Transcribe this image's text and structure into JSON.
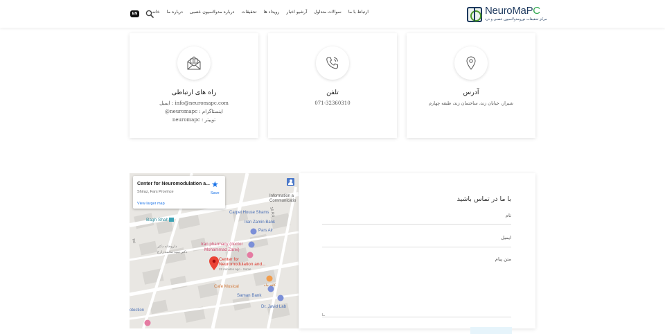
{
  "header": {
    "logo_text_main": "NeuroMaP",
    "logo_text_tail": "C",
    "logo_sub": "مرکز تحقیقات نورومدولاسیون عصبی و درد",
    "nav": [
      "خانه",
      "درباره ما",
      "درباره مدولاسیون عصبی",
      "تحقیقات",
      "رویداد ها",
      "آرشیو اخبار",
      "سوالات متداول",
      "ارتباط با ما"
    ],
    "lang": "EN"
  },
  "cards": {
    "contact": {
      "title": "راه های ارتباطی",
      "lines": [
        "info@neuromapc.com : ایمیل",
        "اینستاگرام : neuromapc@",
        "توییتر : neuromapc"
      ]
    },
    "phone": {
      "title": "تلفن",
      "lines": [
        "071-32360310"
      ]
    },
    "address": {
      "title": "آدرس",
      "lines": [
        "شیراز، خیابان زند، ساختمان زند، طبقه چهارم"
      ]
    }
  },
  "map": {
    "place_title": "Center for Neuromodulation a...",
    "place_sub": "Shiraz, Fars Province",
    "view_larger": "View larger map",
    "save": "Save",
    "labels": {
      "bagh_shah": "Bagh Shah",
      "caravan": "Carpet House Shams",
      "iran_zamin": "Iran Zamin Bank",
      "pars_air": "Pars Air",
      "info_comm_1": "Information a",
      "info_comm_2": "Communicatio",
      "street_16": "16 Rd",
      "pharmacy_fa_1": "داروخانه دکتر",
      "pharmacy_fa_2": "دکتر سید محمد زارع",
      "pharmacy_1": "Iran pharmacy (doctor",
      "pharmacy_2": "Mohammad Zarei)",
      "center_1": "Center for",
      "center_2": "Neuromodulation and...",
      "center_3": "22 minutes ago · Some",
      "cafe": "Cafe Musical",
      "cafe_fa": "کافه ماه",
      "saman": "Saman Bank",
      "javid": "Dr. Javid Lab",
      "protection": "otection",
      "road_left": "Rd"
    }
  },
  "form": {
    "title": "با ما در تماس باشید",
    "name_label": "نام",
    "email_label": "ایمیل",
    "message_label": "متن پیام"
  },
  "colors": {
    "brand": "#1e3a5f",
    "accent_green": "#2fa84f",
    "link_blue": "#1a73e8",
    "pin_red": "#ea4335"
  }
}
